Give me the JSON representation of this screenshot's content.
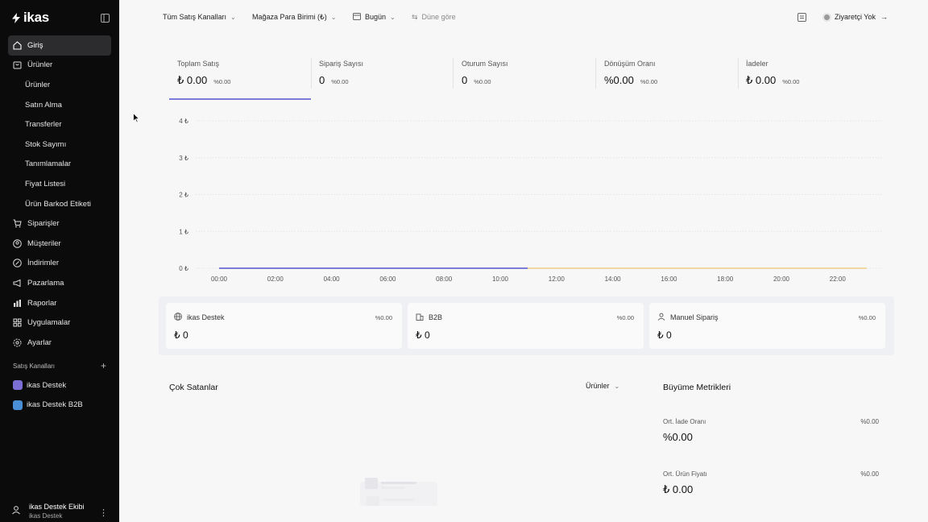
{
  "sidebar": {
    "logo": "ikas",
    "nav": [
      {
        "label": "Giriş",
        "icon": "home-icon",
        "active": true
      },
      {
        "label": "Ürünler",
        "icon": "bag-icon"
      },
      {
        "label": "Ürünler",
        "sub": true
      },
      {
        "label": "Satın Alma",
        "sub": true
      },
      {
        "label": "Transferler",
        "sub": true
      },
      {
        "label": "Stok Sayımı",
        "sub": true
      },
      {
        "label": "Tanımlamalar",
        "sub": true
      },
      {
        "label": "Fiyat Listesi",
        "sub": true
      },
      {
        "label": "Ürün Barkod Etiketi",
        "sub": true
      },
      {
        "label": "Siparişler",
        "icon": "cart-icon"
      },
      {
        "label": "Müşteriler",
        "icon": "customers-icon"
      },
      {
        "label": "İndirimler",
        "icon": "discount-icon"
      },
      {
        "label": "Pazarlama",
        "icon": "megaphone-icon"
      },
      {
        "label": "Raporlar",
        "icon": "reports-icon"
      },
      {
        "label": "Uygulamalar",
        "icon": "apps-icon"
      },
      {
        "label": "Ayarlar",
        "icon": "settings-icon"
      }
    ],
    "channels_title": "Satış Kanalları",
    "channels": [
      {
        "label": "ikas Destek",
        "color": "#7b6fd6"
      },
      {
        "label": "ikas Destek B2B",
        "color": "#4a8fd6"
      }
    ],
    "user": {
      "name": "ikas Destek Ekibi",
      "sub": "ikas Destek"
    }
  },
  "topbar": {
    "channels_filter": "Tüm Satış Kanalları",
    "currency_filter": "Mağaza Para Birimi (₺)",
    "date_filter": "Bugün",
    "compare": "Düne göre",
    "visitor": "Ziyaretçi Yok"
  },
  "metrics": [
    {
      "label": "Toplam Satış",
      "value": "₺ 0.00",
      "pct": "%0.00"
    },
    {
      "label": "Sipariş Sayısı",
      "value": "0",
      "pct": "%0.00"
    },
    {
      "label": "Oturum Sayısı",
      "value": "0",
      "pct": "%0.00"
    },
    {
      "label": "Dönüşüm Oranı",
      "value": "%0.00",
      "pct": "%0.00"
    },
    {
      "label": "İadeler",
      "value": "₺ 0.00",
      "pct": "%0.00"
    }
  ],
  "chart_data": {
    "type": "line",
    "x": [
      "00:00",
      "02:00",
      "04:00",
      "06:00",
      "08:00",
      "10:00",
      "12:00",
      "14:00",
      "16:00",
      "18:00",
      "20:00",
      "22:00"
    ],
    "yticks": [
      "4 ₺",
      "3 ₺",
      "2 ₺",
      "1 ₺",
      "0 ₺"
    ],
    "ylim": [
      0,
      4
    ],
    "grid": true,
    "series": [
      {
        "values": [
          0,
          0,
          0,
          0,
          0,
          0
        ],
        "color": "#7b7bd9"
      },
      {
        "values": [
          0,
          0,
          0,
          0,
          0,
          0,
          0,
          0,
          0,
          0,
          0,
          0
        ],
        "color": "#f0d9a0"
      }
    ]
  },
  "channel_cards": [
    {
      "label": "ikas Destek",
      "icon": "globe-icon",
      "pct": "%0.00",
      "value": "₺ 0"
    },
    {
      "label": "B2B",
      "icon": "building-icon",
      "pct": "%0.00",
      "value": "₺ 0"
    },
    {
      "label": "Manuel Sipariş",
      "icon": "user-icon",
      "pct": "%0.00",
      "value": "₺ 0"
    }
  ],
  "best_sellers": {
    "title": "Çok Satanlar",
    "select": "Ürünler"
  },
  "growth": {
    "title": "Büyüme Metrikleri",
    "items": [
      {
        "label": "Ort. İade Oranı",
        "pct": "%0.00",
        "value": "%0.00"
      },
      {
        "label": "Ort. Ürün Fiyatı",
        "pct": "%0.00",
        "value": "₺ 0.00"
      }
    ]
  }
}
